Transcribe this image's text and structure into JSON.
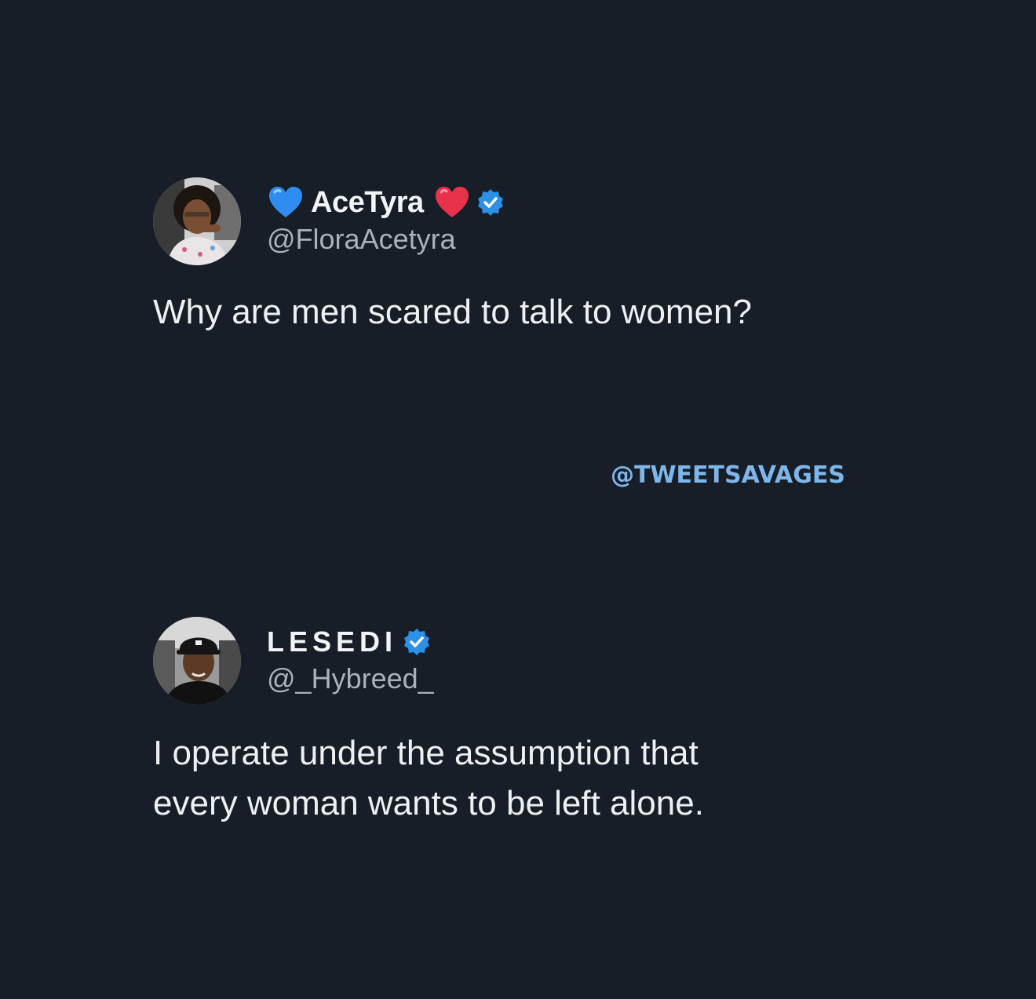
{
  "tweets": [
    {
      "display_name": "AceTyra",
      "handle": "@FloraAcetyra",
      "verified": true,
      "text_lines": [
        "Why are men scared to talk to women?"
      ]
    },
    {
      "display_name": "LESEDI",
      "handle": "@_Hybreed_",
      "verified": true,
      "text_lines": [
        "I operate under the assumption that",
        "every woman wants to be left alone."
      ]
    }
  ],
  "watermark": "@TWEETSAVAGES",
  "colors": {
    "background": "#171e28",
    "verified_badge": "#2d8fe6",
    "watermark": "#7eb6ea",
    "blue_heart": "#2f8cf0",
    "red_heart": "#e8314a"
  },
  "icons": {
    "left_emoji": "blue-heart-icon",
    "right_emoji": "red-heart-icon",
    "badge": "verified-badge-icon"
  }
}
